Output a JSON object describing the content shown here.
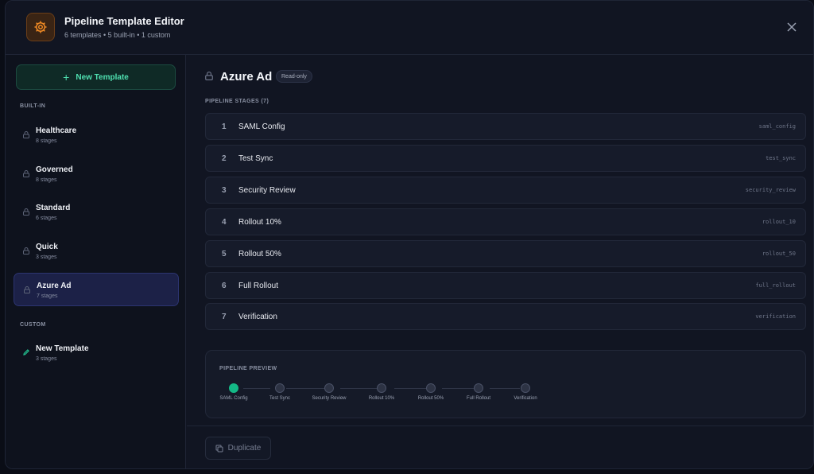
{
  "header": {
    "title": "Pipeline Template Editor",
    "subtitle": "6 templates • 5 built-in • 1 custom",
    "app_icon": "gear-icon",
    "close_icon": "close-icon"
  },
  "sidebar": {
    "new_template_label": "New Template",
    "builtin_label": "BUILT-IN",
    "custom_label": "CUSTOM",
    "builtin_items": [
      {
        "name": "Healthcare",
        "meta": "8 stages"
      },
      {
        "name": "Governed",
        "meta": "8 stages"
      },
      {
        "name": "Standard",
        "meta": "6 stages"
      },
      {
        "name": "Quick",
        "meta": "3 stages"
      },
      {
        "name": "Azure Ad",
        "meta": "7 stages",
        "active": true
      }
    ],
    "custom_items": [
      {
        "name": "New Template",
        "meta": "3 stages"
      }
    ]
  },
  "main": {
    "title": "Azure Ad",
    "badge": "Read-only",
    "stages_label": "PIPELINE STAGES (7)",
    "stages": [
      {
        "num": "1",
        "label": "SAML Config",
        "key": "saml_config"
      },
      {
        "num": "2",
        "label": "Test Sync",
        "key": "test_sync"
      },
      {
        "num": "3",
        "label": "Security Review",
        "key": "security_review"
      },
      {
        "num": "4",
        "label": "Rollout 10%",
        "key": "rollout_10"
      },
      {
        "num": "5",
        "label": "Rollout 50%",
        "key": "rollout_50"
      },
      {
        "num": "6",
        "label": "Full Rollout",
        "key": "full_rollout"
      },
      {
        "num": "7",
        "label": "Verification",
        "key": "verification"
      }
    ],
    "preview": {
      "label": "PIPELINE PREVIEW",
      "steps": [
        {
          "label": "SAML Config",
          "done": true
        },
        {
          "label": "Test Sync",
          "done": false
        },
        {
          "label": "Security Review",
          "done": false
        },
        {
          "label": "Rollout 10%",
          "done": false
        },
        {
          "label": "Rollout 50%",
          "done": false
        },
        {
          "label": "Full Rollout",
          "done": false
        },
        {
          "label": "Verification",
          "done": false
        }
      ]
    },
    "duplicate_label": "Duplicate"
  },
  "colors": {
    "accent_green": "#4fe0b0",
    "active_item_bg": "#1c2147",
    "done_dot": "#14b886",
    "app_icon_orange": "#f08a24"
  }
}
